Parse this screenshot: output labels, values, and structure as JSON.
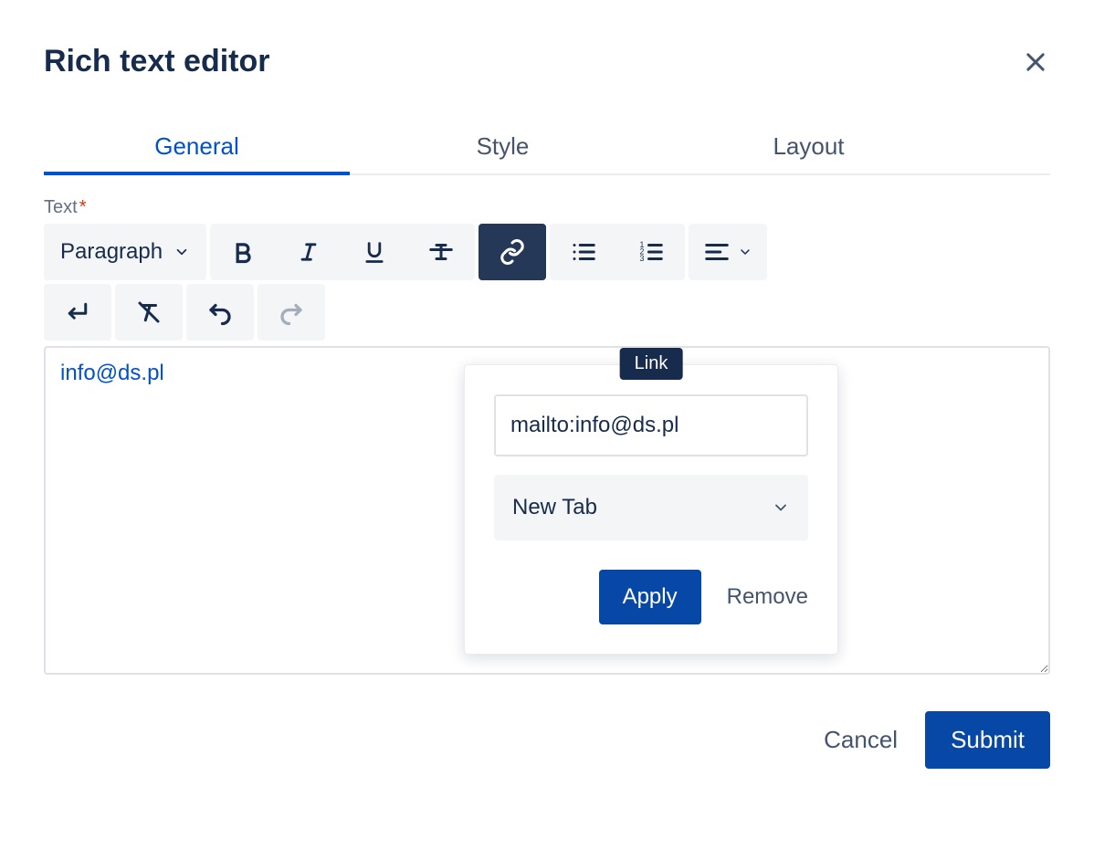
{
  "header": {
    "title": "Rich text editor"
  },
  "tabs": {
    "general": "General",
    "style": "Style",
    "layout": "Layout"
  },
  "field": {
    "label": "Text",
    "required": "*"
  },
  "toolbar": {
    "paragraph": "Paragraph"
  },
  "editor": {
    "link_text": "info@ds.pl"
  },
  "popover": {
    "tooltip": "Link",
    "url": "mailto:info@ds.pl",
    "target": "New Tab",
    "apply": "Apply",
    "remove": "Remove"
  },
  "footer": {
    "cancel": "Cancel",
    "submit": "Submit"
  }
}
